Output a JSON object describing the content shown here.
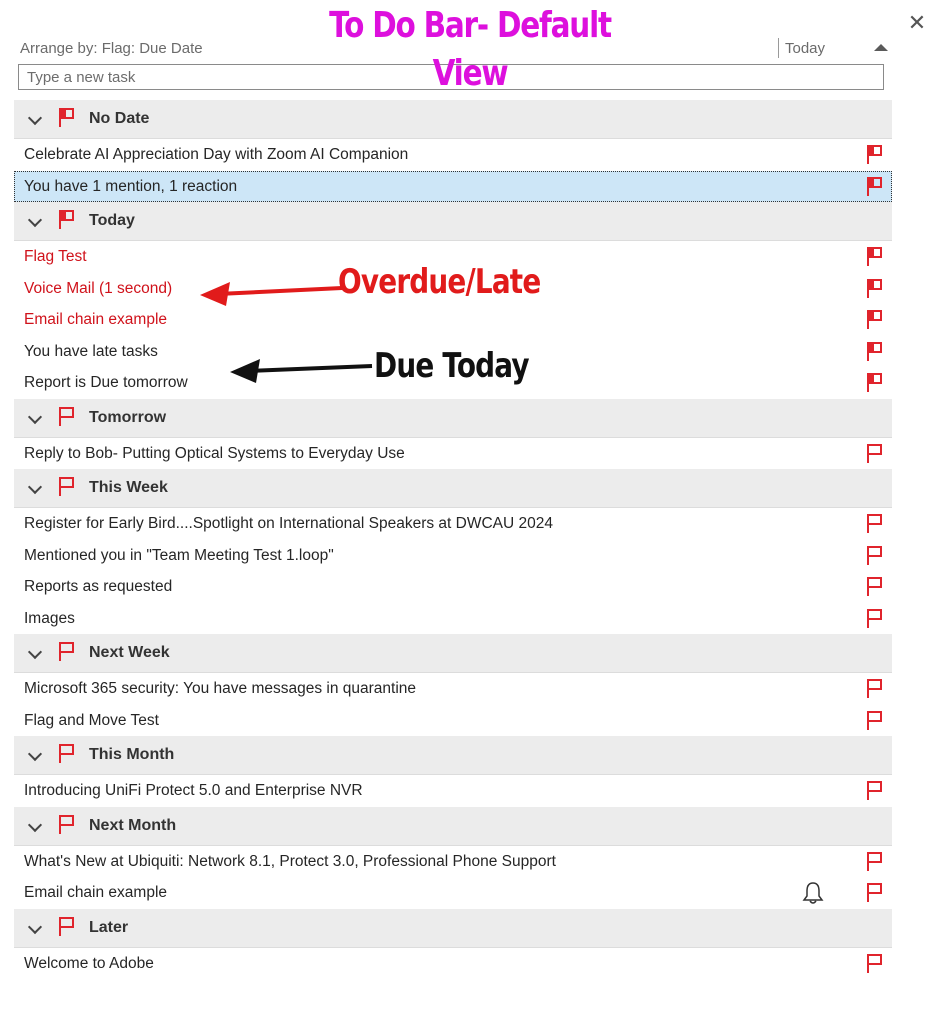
{
  "banner": "To Do Bar- Default View",
  "arrange": {
    "label": "Arrange by: Flag: Due Date",
    "column": "Today"
  },
  "new_task": {
    "placeholder": "Type a new task"
  },
  "groups": [
    {
      "label": "No Date",
      "tasks": [
        {
          "title": "Celebrate AI Appreciation Day with Zoom AI Companion"
        },
        {
          "title": "You have 1 mention, 1 reaction"
        }
      ]
    },
    {
      "label": "Today",
      "tasks": [
        {
          "title": "Flag Test"
        },
        {
          "title": "Voice Mail (1 second)"
        },
        {
          "title": "Email chain example"
        },
        {
          "title": "You have late tasks"
        },
        {
          "title": "Report is Due tomorrow"
        }
      ]
    },
    {
      "label": "Tomorrow",
      "tasks": [
        {
          "title": "Reply to Bob- Putting Optical Systems to Everyday Use"
        }
      ]
    },
    {
      "label": "This Week",
      "tasks": [
        {
          "title": "Register for Early Bird....Spotlight on International Speakers at DWCAU 2024"
        },
        {
          "title": "Mentioned you in \"Team Meeting Test 1.loop\""
        },
        {
          "title": "Reports as requested"
        },
        {
          "title": "Images"
        }
      ]
    },
    {
      "label": "Next Week",
      "tasks": [
        {
          "title": "Microsoft 365 security: You have messages in quarantine"
        },
        {
          "title": "Flag and Move Test"
        }
      ]
    },
    {
      "label": "This Month",
      "tasks": [
        {
          "title": "Introducing UniFi Protect 5.0 and Enterprise NVR"
        }
      ]
    },
    {
      "label": "Next Month",
      "tasks": [
        {
          "title": "What's New at Ubiquiti: Network 8.1, Protect 3.0, Professional Phone Support"
        },
        {
          "title": "Email chain example"
        }
      ]
    },
    {
      "label": "Later",
      "tasks": [
        {
          "title": "Welcome to Adobe"
        }
      ]
    }
  ],
  "annotations": {
    "overdue": "Overdue/Late",
    "due_today": "Due Today"
  },
  "colors": {
    "banner": "#dd10dd",
    "overdue_text": "#d0121b",
    "flag": "#e0242c",
    "selected_row": "#cde6f7",
    "group_header": "#ececec"
  },
  "icons": {
    "close": "close-icon",
    "sort": "sort-ascending-icon",
    "expand": "chevron-down-icon",
    "flag": "flag-icon",
    "reminder": "bell-icon"
  }
}
